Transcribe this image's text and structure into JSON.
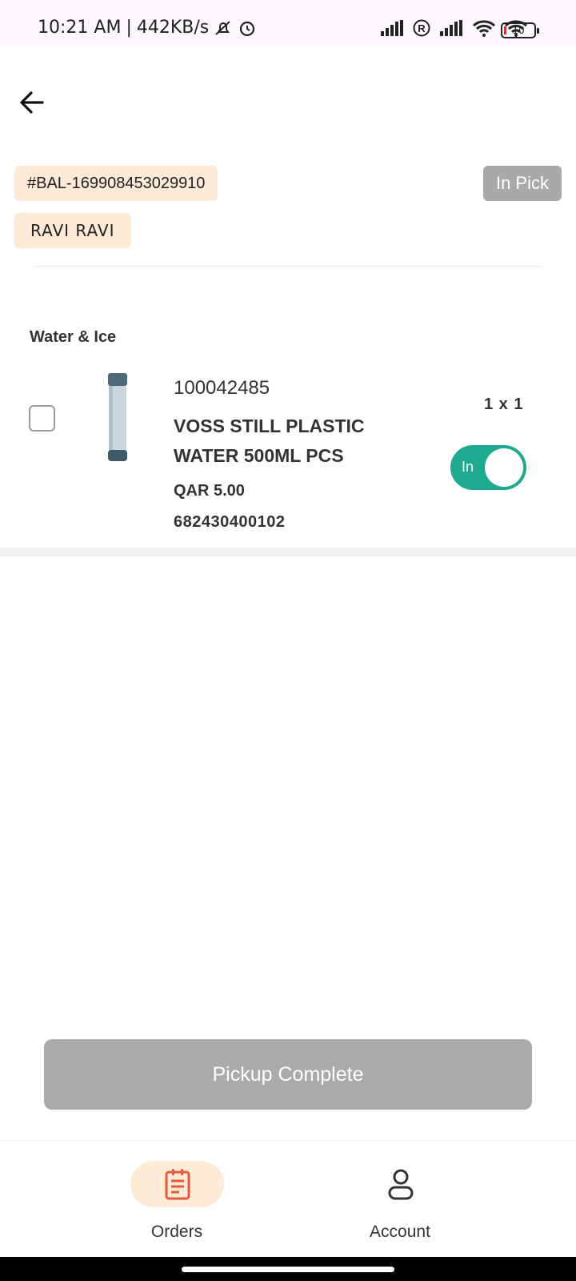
{
  "status_bar": {
    "time": "10:21 AM",
    "separator": "|",
    "net_speed": "442KB/s",
    "battery_level": "10",
    "icons": [
      "mute-icon",
      "alarm-icon",
      "signal-icon",
      "registered-icon",
      "signal-icon",
      "wifi-icon",
      "wifi-icon",
      "battery-icon"
    ]
  },
  "header": {
    "back_icon": "arrow-left-icon"
  },
  "order": {
    "id": "#BAL-169908453029910",
    "customer": "RAVI  RAVI",
    "status": "In Pick"
  },
  "category": "Water & Ice",
  "item": {
    "sku": "100042485",
    "name": "VOSS STILL PLASTIC WATER  500ML PCS",
    "price": "QAR 5.00",
    "barcode": "682430400102",
    "quantity": "1 x 1",
    "toggle_label": "In",
    "toggle_on": true,
    "checked": false,
    "image": "water-bottle-image"
  },
  "actions": {
    "pickup_complete": "Pickup Complete"
  },
  "bottom_nav": {
    "items": [
      {
        "label": "Orders",
        "icon": "orders-icon",
        "active": true
      },
      {
        "label": "Account",
        "icon": "account-icon",
        "active": false
      }
    ]
  },
  "colors": {
    "chip_bg": "#fdebd8",
    "status_badge": "#a9a9a9",
    "toggle_on": "#1fa98f",
    "button_disabled": "#a9aaa9",
    "orders_icon": "#e55a3c"
  }
}
